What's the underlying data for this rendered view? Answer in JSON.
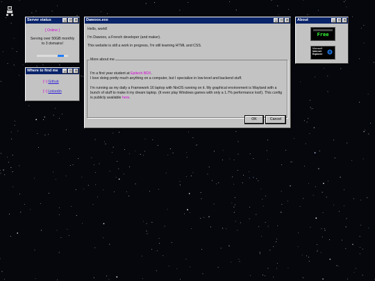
{
  "server_window": {
    "title": "Server status",
    "status": "[ Online ]",
    "description": "Serving over 50GB monthly to 3 domains!",
    "progress": 0.75
  },
  "find_window": {
    "title": "Where to find me",
    "links": [
      {
        "bracket": "[~]",
        "label": "Github"
      },
      {
        "bracket": "[~]",
        "label": "Linkedin"
      }
    ]
  },
  "main_window": {
    "title": "Dawoox.exe",
    "greeting": "Hello, world!",
    "intro": "I'm Dawoox, a French developer (and maker).",
    "wip": "This website is still a work in progress, I'm still learning HTML and CSS.",
    "more_legend": "More about me",
    "student_prefix": "I'm a first year student at ",
    "school": "Epitech BDX",
    "student_suffix": ".",
    "likes": "I love doing pretty much anything on a computer, but I specialize in low-level and backend stuff.",
    "setup_text": "I'm running as my daily a Framework 16 laptop with NixOS running on it. My graphical environment is Wayland with a bunch of stuff to make it my dream laptop. (It even play Windows games with only a 1.7% performance lost!). This config is publicly available ",
    "here_link": "here",
    "setup_end": ".",
    "ok_label": "OK",
    "cancel_label": "Cancel"
  },
  "about_window": {
    "title": "About",
    "badge1_top": "Free",
    "badge2_line1": "Microsoft",
    "badge2_line2": "Internet",
    "badge2_line3": "Explorer"
  },
  "window_buttons": {
    "minimize": "_",
    "maximize": "□",
    "close": "x"
  },
  "colors": {
    "titlebar": "#0a246a",
    "window": "#c3c3c3",
    "accent_magenta": "#d400d4",
    "link": "#2a1bd6",
    "progress": "#1e7cff"
  }
}
